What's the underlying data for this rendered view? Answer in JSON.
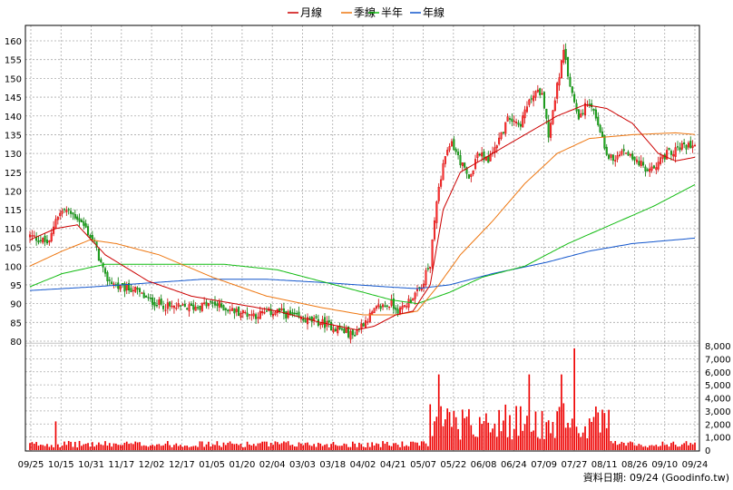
{
  "chart_data": {
    "type": "candlestick",
    "legend": [
      {
        "name": "月線",
        "color": "#cc0000"
      },
      {
        "name": "季線",
        "color": "#ee7711"
      },
      {
        "name": "半年",
        "color": "#11bb11"
      },
      {
        "name": "年線",
        "color": "#1155cc"
      }
    ],
    "price_axis": {
      "ticks": [
        80,
        85,
        90,
        95,
        100,
        105,
        110,
        115,
        120,
        125,
        130,
        135,
        140,
        145,
        150,
        155,
        160
      ],
      "ylim": [
        78,
        163
      ]
    },
    "volume_axis": {
      "ticks": [
        "0",
        "1,000",
        "2,000",
        "3,000",
        "4,000",
        "5,000",
        "6,000",
        "7,000",
        "8,000"
      ],
      "ylim": [
        0,
        8200
      ]
    },
    "x_ticks": [
      "09/25",
      "10/15",
      "10/31",
      "11/17",
      "12/02",
      "12/17",
      "01/05",
      "01/20",
      "02/04",
      "03/03",
      "03/18",
      "04/02",
      "04/21",
      "05/07",
      "05/22",
      "06/08",
      "06/24",
      "07/09",
      "07/27",
      "08/11",
      "08/26",
      "09/10",
      "09/24"
    ],
    "grid": true,
    "ma_month": [
      [
        0,
        107
      ],
      [
        12,
        110
      ],
      [
        22,
        111
      ],
      [
        35,
        103
      ],
      [
        55,
        96
      ],
      [
        75,
        92
      ],
      [
        95,
        90
      ],
      [
        115,
        88
      ],
      [
        135,
        85
      ],
      [
        152,
        83
      ],
      [
        160,
        84
      ],
      [
        170,
        87
      ],
      [
        178,
        88
      ],
      [
        186,
        95
      ],
      [
        192,
        115
      ],
      [
        200,
        125
      ],
      [
        215,
        130
      ],
      [
        230,
        135
      ],
      [
        245,
        140
      ],
      [
        258,
        143
      ],
      [
        268,
        142
      ],
      [
        280,
        138
      ],
      [
        292,
        130
      ],
      [
        300,
        128
      ],
      [
        309,
        129
      ],
      [
        310,
        129
      ]
    ],
    "ma_quarter": [
      [
        0,
        100
      ],
      [
        15,
        104
      ],
      [
        28,
        107
      ],
      [
        40,
        106
      ],
      [
        60,
        103
      ],
      [
        85,
        97
      ],
      [
        110,
        92
      ],
      [
        135,
        89
      ],
      [
        155,
        87
      ],
      [
        170,
        87
      ],
      [
        180,
        88
      ],
      [
        190,
        95
      ],
      [
        200,
        103
      ],
      [
        215,
        112
      ],
      [
        230,
        122
      ],
      [
        245,
        130
      ],
      [
        260,
        134
      ],
      [
        280,
        135
      ],
      [
        300,
        135.5
      ],
      [
        310,
        135
      ]
    ],
    "ma_half": [
      [
        0,
        94.5
      ],
      [
        15,
        98
      ],
      [
        35,
        100.5
      ],
      [
        60,
        100.5
      ],
      [
        90,
        100.5
      ],
      [
        115,
        99
      ],
      [
        135,
        96
      ],
      [
        155,
        93
      ],
      [
        168,
        91
      ],
      [
        180,
        90
      ],
      [
        195,
        93
      ],
      [
        210,
        97
      ],
      [
        230,
        100
      ],
      [
        250,
        106
      ],
      [
        270,
        111
      ],
      [
        290,
        116
      ],
      [
        310,
        122
      ]
    ],
    "ma_year": [
      [
        0,
        93.5
      ],
      [
        30,
        94.5
      ],
      [
        55,
        95.5
      ],
      [
        80,
        96.5
      ],
      [
        110,
        96.5
      ],
      [
        140,
        95.5
      ],
      [
        165,
        94.5
      ],
      [
        180,
        94
      ],
      [
        195,
        95
      ],
      [
        215,
        98
      ],
      [
        240,
        101
      ],
      [
        260,
        104
      ],
      [
        280,
        106
      ],
      [
        310,
        107.5
      ]
    ],
    "source_note": "資料日期: 09/24 (Goodinfo.tw)"
  }
}
